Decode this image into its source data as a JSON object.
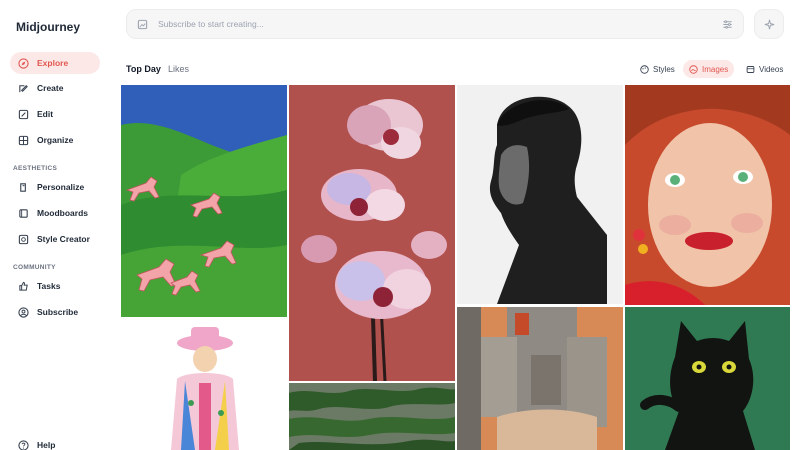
{
  "app": {
    "name": "Midjourney"
  },
  "sidebar": {
    "items": [
      {
        "label": "Explore",
        "icon": "compass-icon",
        "active": true
      },
      {
        "label": "Create",
        "icon": "create-icon",
        "active": false
      },
      {
        "label": "Edit",
        "icon": "edit-icon",
        "active": false
      },
      {
        "label": "Organize",
        "icon": "grid-icon",
        "active": false
      }
    ],
    "aesthetics_label": "AESTHETICS",
    "aesthetics_items": [
      {
        "label": "Personalize",
        "icon": "personalize-icon"
      },
      {
        "label": "Moodboards",
        "icon": "moodboard-icon"
      },
      {
        "label": "Style Creator",
        "icon": "style-creator-icon"
      }
    ],
    "community_label": "COMMUNITY",
    "community_items": [
      {
        "label": "Tasks",
        "icon": "thumbs-up-icon"
      },
      {
        "label": "Subscribe",
        "icon": "user-circle-icon"
      }
    ],
    "help_label": "Help"
  },
  "search": {
    "placeholder": "Subscribe to start creating..."
  },
  "tabs": {
    "top_day": "Top Day",
    "likes": "Likes"
  },
  "views": {
    "styles": "Styles",
    "images": "Images",
    "videos": "Videos",
    "active": "Images"
  },
  "colors": {
    "accent": "#e0574f",
    "accent_bg": "#fde8e8"
  },
  "gallery": [
    "green-hills-horses-image",
    "iridescent-orchid-image",
    "bw-portrait-man-image",
    "freckled-woman-portrait-image",
    "illustrated-figure-hat-image",
    "hedge-maze-image",
    "rusty-machinery-image",
    "black-cat-image"
  ]
}
